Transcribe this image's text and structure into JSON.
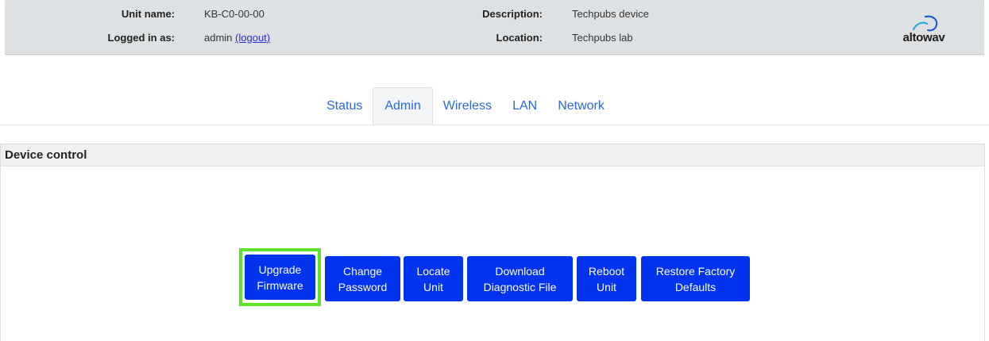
{
  "header": {
    "unit_name_label": "Unit name:",
    "unit_name_value": "KB-C0-00-00",
    "logged_in_label": "Logged in as:",
    "logged_in_value": "admin",
    "logout_label": "(logout)",
    "description_label": "Description:",
    "description_value": "Techpubs device",
    "location_label": "Location:",
    "location_value": "Techpubs lab",
    "logo_text": "altowav",
    "logo_icon": "altowav-logo-icon"
  },
  "tabs": [
    {
      "label": "Status",
      "active": false
    },
    {
      "label": "Admin",
      "active": true
    },
    {
      "label": "Wireless",
      "active": false
    },
    {
      "label": "LAN",
      "active": false
    },
    {
      "label": "Network",
      "active": false
    }
  ],
  "panel": {
    "title": "Device control"
  },
  "buttons": {
    "upgrade_firmware": {
      "line1": "Upgrade",
      "line2": "Firmware"
    },
    "change_password": {
      "line1": "Change",
      "line2": "Password"
    },
    "locate_unit": {
      "line1": "Locate",
      "line2": "Unit"
    },
    "download_diagnostic": {
      "line1": "Download",
      "line2": "Diagnostic File"
    },
    "reboot_unit": {
      "line1": "Reboot",
      "line2": "Unit"
    },
    "restore_defaults": {
      "line1": "Restore Factory",
      "line2": "Defaults"
    }
  },
  "colors": {
    "header_bg": "#dde1e4",
    "tab_text": "#2a6ad8",
    "button_bg": "#0033ee",
    "highlight": "#5ee32b",
    "link": "#2b2bd8"
  }
}
